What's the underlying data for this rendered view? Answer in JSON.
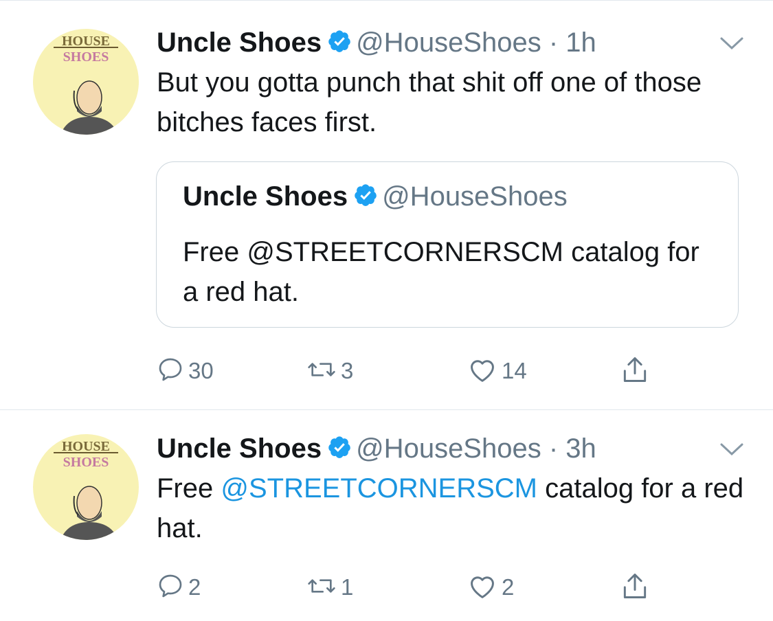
{
  "tweets": [
    {
      "name": "Uncle Shoes",
      "handle": "@HouseShoes",
      "time": "1h",
      "text": "But you gotta punch that shit off one of those bitches faces first.",
      "quote": {
        "name": "Uncle Shoes",
        "handle": "@HouseShoes",
        "text": "Free @STREETCORNERSCM catalog for a red hat."
      },
      "replies": "30",
      "retweets": "3",
      "likes": "14"
    },
    {
      "name": "Uncle Shoes",
      "handle": "@HouseShoes",
      "time": "3h",
      "text_prefix": "Free ",
      "text_mention": "@STREETCORNERSCM",
      "text_suffix": " catalog for a red hat.",
      "replies": "2",
      "retweets": "1",
      "likes": "2"
    }
  ],
  "avatar_text": {
    "line1": "HOUSE",
    "line2": "SHOES"
  },
  "colors": {
    "link": "#1b95e0",
    "verified": "#1da1f2",
    "muted": "#657786",
    "border": "#e1e8ed"
  },
  "icons": [
    "verified-badge-icon",
    "chevron-down-icon",
    "reply-icon",
    "retweet-icon",
    "like-icon",
    "share-icon"
  ]
}
